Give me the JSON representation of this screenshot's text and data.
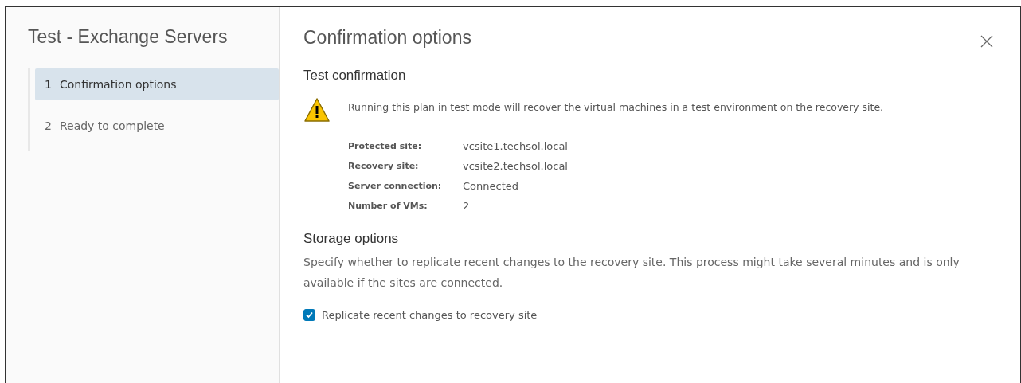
{
  "sidebar": {
    "title": "Test - Exchange Servers",
    "steps": [
      {
        "number": "1",
        "label": "Confirmation options",
        "selected": true
      },
      {
        "number": "2",
        "label": "Ready to complete",
        "selected": false
      }
    ]
  },
  "main": {
    "title": "Confirmation options",
    "test_confirmation": {
      "heading": "Test confirmation",
      "message": "Running this plan in test mode will recover the virtual machines in a test environment on the recovery site.",
      "details": [
        {
          "label": "Protected site:",
          "value": "vcsite1.techsol.local"
        },
        {
          "label": "Recovery site:",
          "value": "vcsite2.techsol.local"
        },
        {
          "label": "Server connection:",
          "value": "Connected"
        },
        {
          "label": "Number of VMs:",
          "value": "2"
        }
      ]
    },
    "storage_options": {
      "heading": "Storage options",
      "description": "Specify whether to replicate recent changes to the recovery site. This process might take several minutes and is only available if the sites are connected.",
      "checkbox": {
        "label": "Replicate recent changes to recovery site",
        "checked": true
      }
    }
  }
}
